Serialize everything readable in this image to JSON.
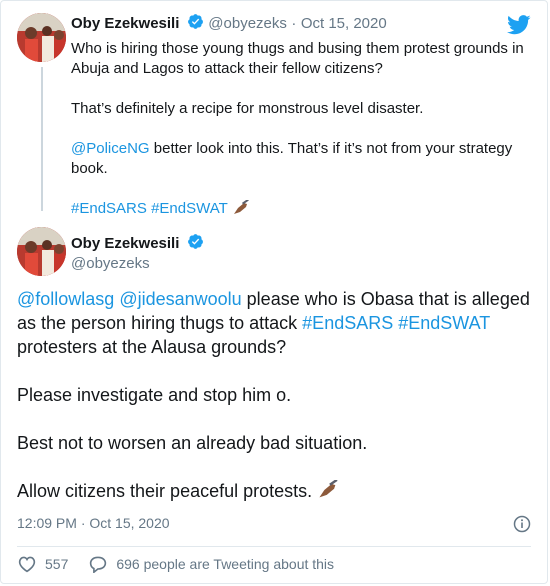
{
  "quoted": {
    "name": "Oby Ezekwesili",
    "handle": "@obyezeks",
    "separator": "·",
    "date": "Oct 15, 2020",
    "para1": "Who is hiring those young thugs and busing them protest grounds in Abuja and Lagos to attack their fellow citizens?",
    "para2": "That’s definitely a recipe for monstrous level disaster.",
    "mention": "@PoliceNG",
    "para3_rest": " better look into this. That’s if it’s not from your strategy book.",
    "hashtag1": "#EndSARS",
    "hashtag2": "#EndSWAT"
  },
  "main": {
    "name": "Oby Ezekwesili",
    "handle": "@obyezeks",
    "mention1": "@followlasg",
    "mention2": "@jidesanwoolu",
    "text1": " please who is Obasa that is alleged as the person hiring thugs to attack ",
    "hashtag1": "#EndSARS",
    "hashtag2": "#EndSWAT",
    "text2": " protesters at  the Alausa grounds?",
    "para2": "Please investigate and stop him o.",
    "para3": "Best not to worsen an already bad situation.",
    "para4": "Allow citizens their peaceful protests.",
    "timestamp": "12:09 PM · Oct 15, 2020",
    "likes": "557",
    "retweet_text": "696 people are Tweeting about this"
  },
  "colors": {
    "link": "#1b95e0",
    "muted": "#657786",
    "verified": "#1da1f2",
    "like": "#657786"
  },
  "icons": [
    "twitter-logo-icon",
    "verified-icon",
    "writing-hand-emoji",
    "info-icon",
    "heart-icon",
    "comment-icon"
  ]
}
